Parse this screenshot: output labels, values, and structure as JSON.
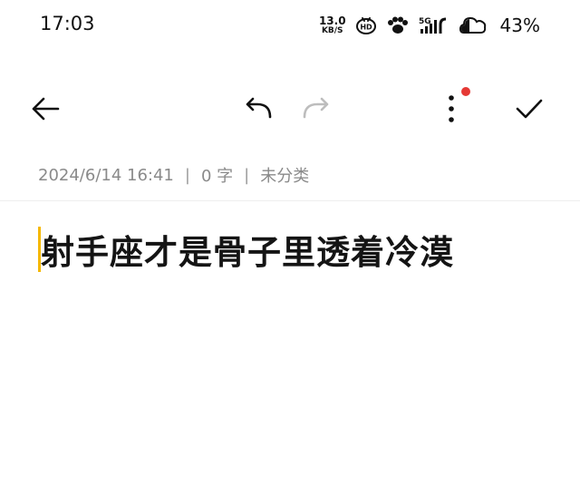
{
  "status_bar": {
    "time": "17:03",
    "net_speed_value": "13.0",
    "net_speed_unit": "KB/S",
    "hd_label": "HD",
    "signal_label": "5G",
    "battery_percent": "43%"
  },
  "toolbar": {
    "back_icon": "arrow-left-icon",
    "undo_icon": "undo-icon",
    "redo_icon": "redo-icon",
    "more_icon": "more-vertical-icon",
    "confirm_icon": "check-icon",
    "badge_color": "#e53935"
  },
  "note_meta": {
    "datetime": "2024/6/14 16:41",
    "word_count": "0 字",
    "category": "未分类",
    "separator": "|"
  },
  "note": {
    "title": "射手座才是骨子里透着冷漠"
  },
  "colors": {
    "caret": "#f5b800",
    "text": "#141414",
    "meta_text": "#8a8a8a"
  }
}
